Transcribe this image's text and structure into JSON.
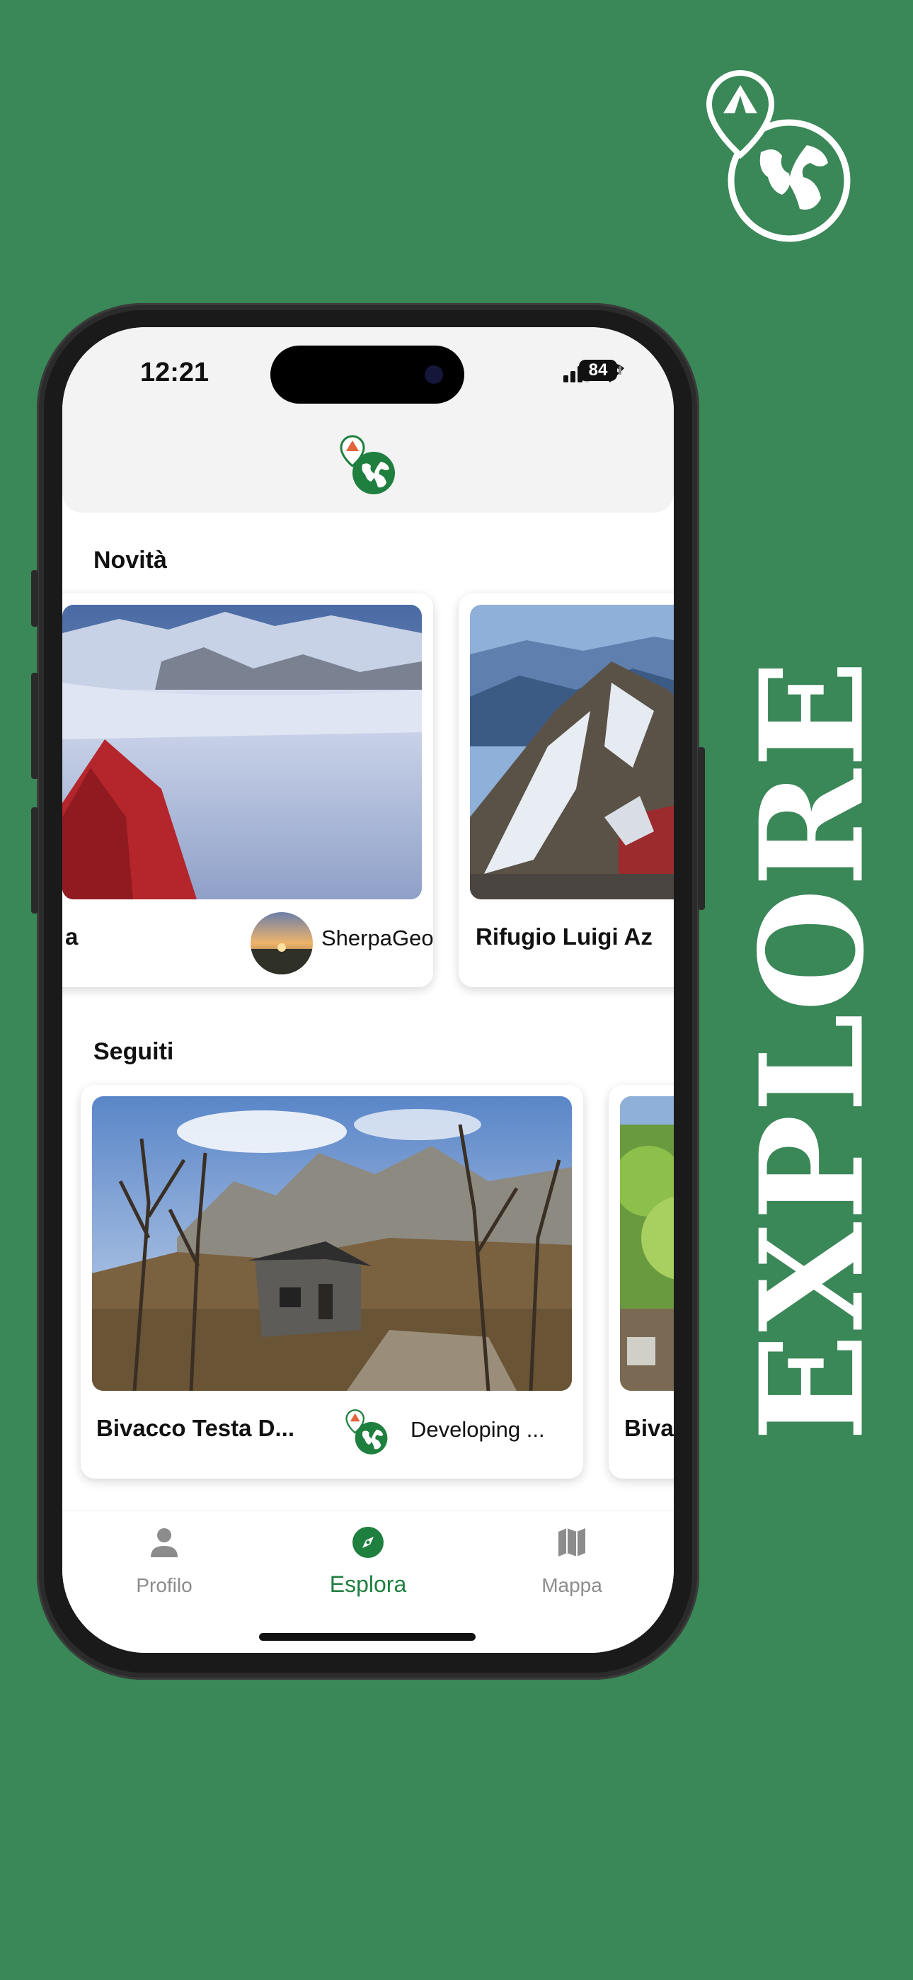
{
  "promo": {
    "headline": "EXPLORE",
    "icon": "app-logo-icon"
  },
  "status_bar": {
    "time": "12:21",
    "battery": "84"
  },
  "sections": {
    "new": {
      "title": "Novità",
      "cards": [
        {
          "title": "a",
          "author": "SherpaGeo",
          "photo": "snowy-camp-photo"
        },
        {
          "title": "Rifugio Luigi Az",
          "author": "",
          "photo": "mountain-refuge-photo"
        }
      ]
    },
    "followed": {
      "title": "Seguiti",
      "cards": [
        {
          "title": "Bivacco Testa D...",
          "author": "Developing ...",
          "photo": "stone-hut-photo"
        },
        {
          "title": "Biva",
          "author": "",
          "photo": "green-forest-photo"
        }
      ]
    }
  },
  "tabbar": {
    "tabs": [
      {
        "label": "Profilo",
        "icon": "person-icon",
        "active": false
      },
      {
        "label": "Esplora",
        "icon": "compass-icon",
        "active": true
      },
      {
        "label": "Mappa",
        "icon": "map-icon",
        "active": false
      }
    ]
  },
  "colors": {
    "background": "#3a8757",
    "accent": "#1f7f3f",
    "pin_orange": "#e2643a",
    "inactive_tab": "#8c8c8c"
  }
}
